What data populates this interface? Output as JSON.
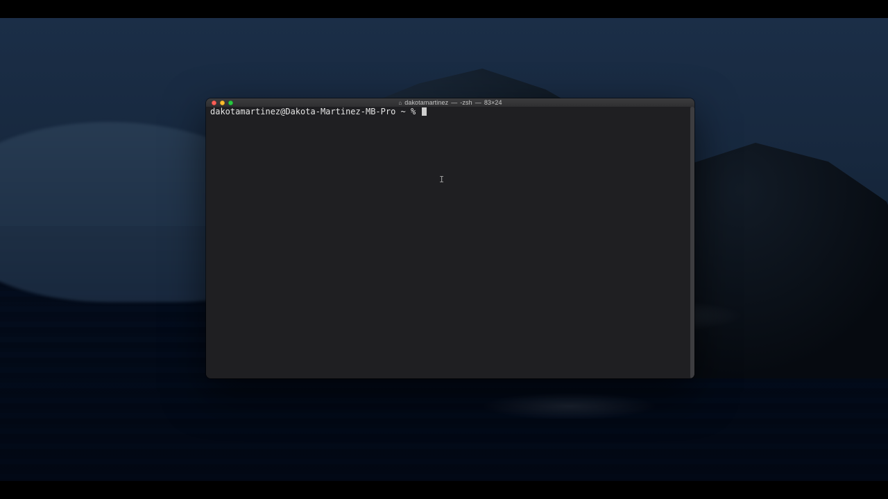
{
  "window": {
    "title_folder": "dakotamartinez",
    "title_process": "-zsh",
    "title_size": "83×24"
  },
  "terminal": {
    "prompt": "dakotamartinez@Dakota-Martinez-MB-Pro ~ % ",
    "caret_glyph": "I"
  },
  "colors": {
    "terminal_bg": "#1f1f22",
    "terminal_fg": "#e6e6e6",
    "close": "#ff5f57",
    "minimize": "#febc2e",
    "zoom": "#28c840"
  }
}
